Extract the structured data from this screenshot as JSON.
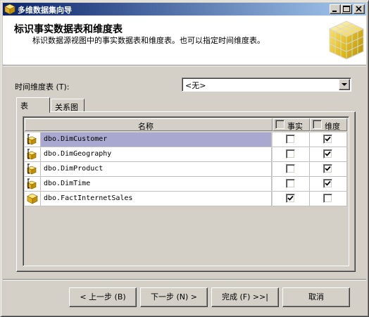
{
  "window": {
    "title": "多维数据集向导",
    "controls": [
      "minimize",
      "maximize",
      "close"
    ]
  },
  "header": {
    "title": "标识事实数据表和维度表",
    "subtitle": "标识数据源视图中的事实数据表和维度表。也可以指定时间维度表。",
    "logo_icon": "cube-icon"
  },
  "time_dimension": {
    "label": "时间维度表 (T):",
    "selected": "<无>"
  },
  "tabs": [
    {
      "label": "表",
      "active": true
    },
    {
      "label": "关系图",
      "active": false
    }
  ],
  "grid": {
    "columns": {
      "name": "名称",
      "fact": "事实",
      "dimension": "维度"
    },
    "header_fact_checked": false,
    "header_dimension_checked": false,
    "rows": [
      {
        "name": "dbo.DimCustomer",
        "icon": "dimension-table-icon",
        "fact": false,
        "dimension": true,
        "selected": true
      },
      {
        "name": "dbo.DimGeography",
        "icon": "dimension-table-icon",
        "fact": false,
        "dimension": true,
        "selected": false
      },
      {
        "name": "dbo.DimProduct",
        "icon": "dimension-table-icon",
        "fact": false,
        "dimension": true,
        "selected": false
      },
      {
        "name": "dbo.DimTime",
        "icon": "dimension-table-icon",
        "fact": false,
        "dimension": true,
        "selected": false
      },
      {
        "name": "dbo.FactInternetSales",
        "icon": "fact-table-icon",
        "fact": true,
        "dimension": false,
        "selected": false
      }
    ]
  },
  "buttons": {
    "back": "< 上一步 (B)",
    "next": "下一步 (N) >",
    "finish": "完成 (F) >>|",
    "cancel": "取消"
  }
}
